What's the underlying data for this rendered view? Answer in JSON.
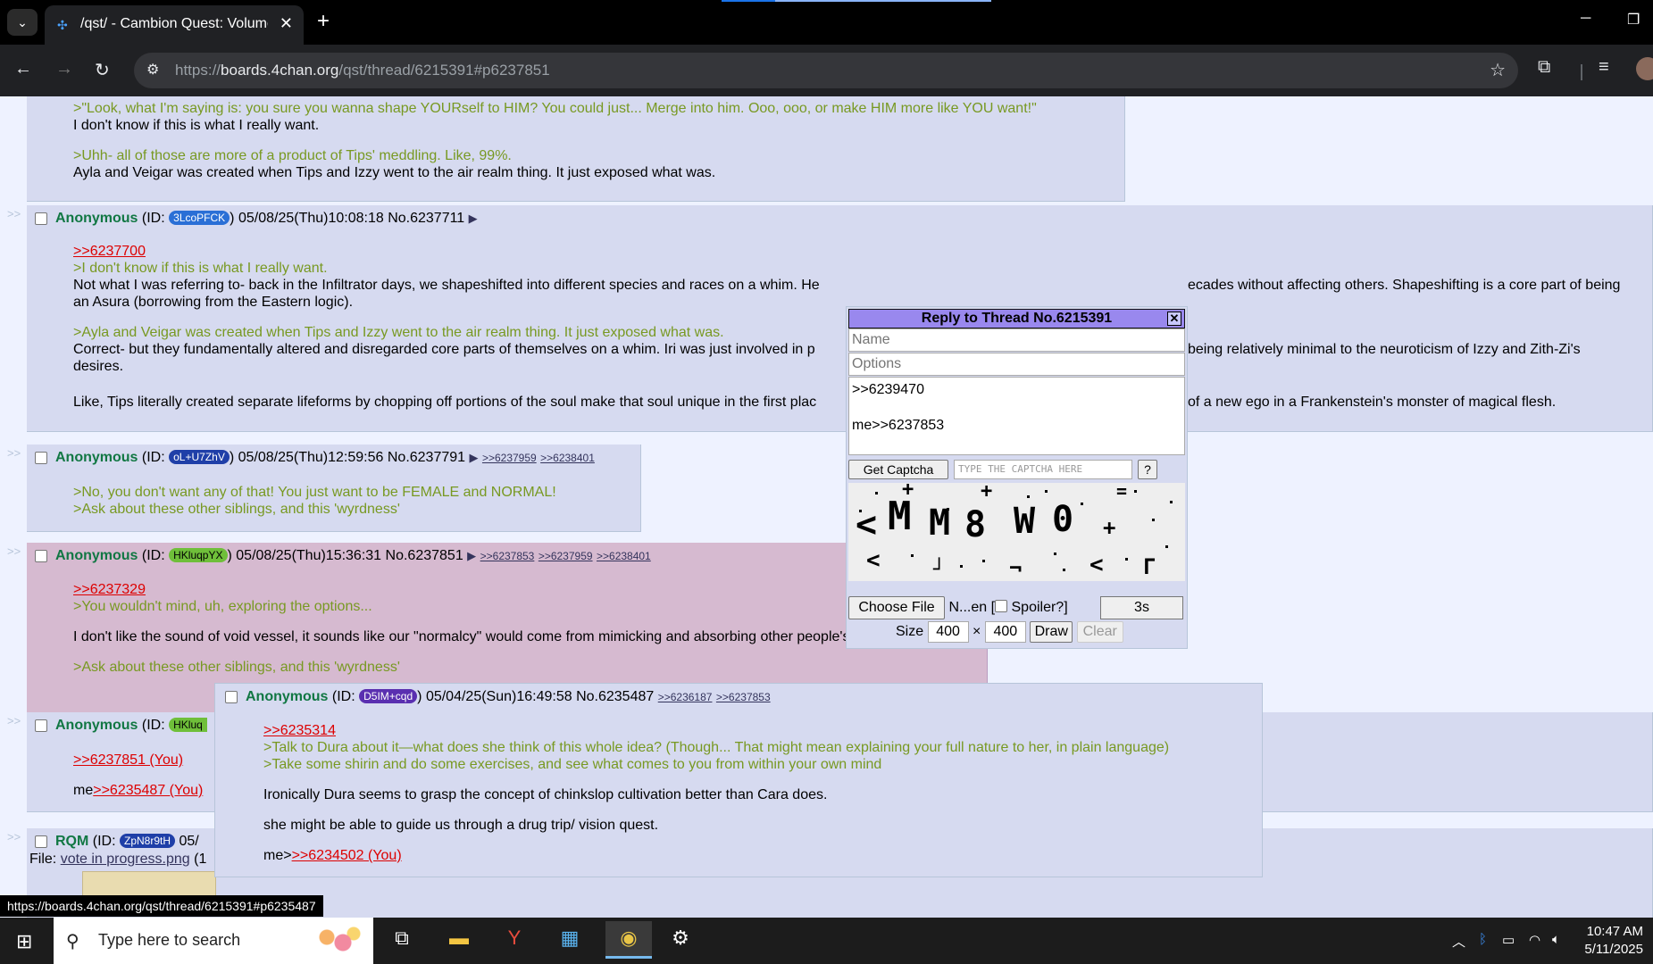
{
  "browser": {
    "tab_title": "/qst/ - Cambion Quest: Volume",
    "url_scheme": "https://",
    "url_host": "boards.4chan.org",
    "url_path": "/qst/thread/6215391#p6237851"
  },
  "post0": {
    "lines": [
      ">\"Look, what I'm saying is: you sure you wanna shape YOURself to HIM? You could just... Merge into him. Ooo, ooo, or make HIM more like YOU want!\"",
      "I don't know if this is what I really want.",
      ">Uhh- all of those are more of a product of Tips' meddling. Like, 99%.",
      "Ayla and Veigar was created when Tips and Izzy went to the air realm thing. It just exposed what was."
    ]
  },
  "post1": {
    "name": "Anonymous",
    "id_prefix": "(ID:",
    "id": "3LcoPFCK",
    "id_suffix": ")",
    "datetime": "05/08/25(Thu)10:08:18",
    "number": "No.6237711",
    "quotelink": ">>6237700",
    "lines": [
      ">I don't know if this is what I really want.",
      "Not what I was referring to- back in the Infiltrator days, we shapeshifted into different species and races on a whim. He",
      "ecades without affecting others. Shapeshifting is a core part of being",
      "an Asura (borrowing from the Eastern logic).",
      ">Ayla and Veigar was created when Tips and Izzy went to the air realm thing. It just exposed what was.",
      "Correct- but they fundamentally altered and disregarded core parts of themselves on a whim. Iri was just involved in p",
      "being relatively minimal to the neuroticism of Izzy and Zith-Zi's",
      "desires.",
      "Like, Tips literally created separate lifeforms by chopping off portions of the soul make that soul unique in the first plac",
      "of a new ego in a Frankenstein's monster of magical flesh."
    ]
  },
  "post2": {
    "name": "Anonymous",
    "id": "oL+U7ZhV",
    "datetime": "05/08/25(Thu)12:59:56",
    "number": "No.6237791",
    "backlinks": [
      ">>6237959",
      ">>6238401"
    ],
    "lines": [
      ">No, you don't want any of that! You just want to be FEMALE and NORMAL!",
      ">Ask about these other siblings, and this 'wyrdness'"
    ]
  },
  "post3": {
    "name": "Anonymous",
    "id": "HKluqpYX",
    "datetime": "05/08/25(Thu)15:36:31",
    "number": "No.6237851",
    "backlinks": [
      ">>6237853",
      ">>6237959",
      ">>6238401"
    ],
    "quotelink": ">>6237329",
    "lines": [
      ">You wouldn't mind, uh, exploring the options...",
      "I don't like the sound of void vessel, it sounds like our \"normalcy\" would come from mimicking and absorbing other people's desires.",
      ">Ask about these other siblings, and this 'wyrdness'"
    ]
  },
  "post4": {
    "name": "Anonymous",
    "id_prefix": "(ID:",
    "id": "HKluq",
    "quotelink": ">>6237851 (You)",
    "me_prefix": "me",
    "me_link": ">>6235487 (You)"
  },
  "post5": {
    "name": "RQM",
    "id_prefix": "(ID:",
    "id": "ZpN8r9tH",
    "date_frag": "05/",
    "file_label": "File:",
    "file_name": "vote in progress.png",
    "file_meta": "(1"
  },
  "preview": {
    "name": "Anonymous",
    "id": "D5IM+cqd",
    "datetime": "05/04/25(Sun)16:49:58",
    "number": "No.6235487",
    "backlinks": [
      ">>6236187",
      ">>6237853"
    ],
    "quotelink": ">>6235314",
    "lines": [
      ">Talk to Dura about it—what does she think of this whole idea? (Though... That might mean explaining your full nature to her, in plain language)",
      ">Take some shirin and do some exercises, and see what comes to you from within your own mind",
      "Ironically Dura seems to grasp the concept of chinkslop cultivation better than Cara does.",
      "she might be able to guide us through a drug trip/ vision quest."
    ],
    "me_prefix": "me>",
    "me_link": ">>6234502 (You)"
  },
  "quick_reply": {
    "title": "Reply to Thread No.6215391",
    "name_placeholder": "Name",
    "options_placeholder": "Options",
    "comment_line1": ">>6239470",
    "comment_line2": "me>>6237853",
    "get_captcha": "Get Captcha",
    "captcha_placeholder": "TYPE THE CAPTCHA HERE",
    "help": "?",
    "choose_file": "Choose File",
    "file_status": "N...en",
    "spoiler_open": "[",
    "spoiler_label": "Spoiler?]",
    "timer": "3s",
    "size_label": "Size",
    "width": "400",
    "times": "×",
    "height": "400",
    "draw": "Draw",
    "clear": "Clear"
  },
  "status_url": "https://boards.4chan.org/qst/thread/6215391#p6235487",
  "taskbar": {
    "search_placeholder": "Type here to search",
    "time": "10:47 AM",
    "date": "5/11/2025"
  },
  "colors": {
    "post_bg": "#d6daf0",
    "highlight_bg": "#d6bad0",
    "greentext": "#789922",
    "quotelink": "#dd0000",
    "name": "#117743",
    "qr_header": "#9988ee"
  }
}
